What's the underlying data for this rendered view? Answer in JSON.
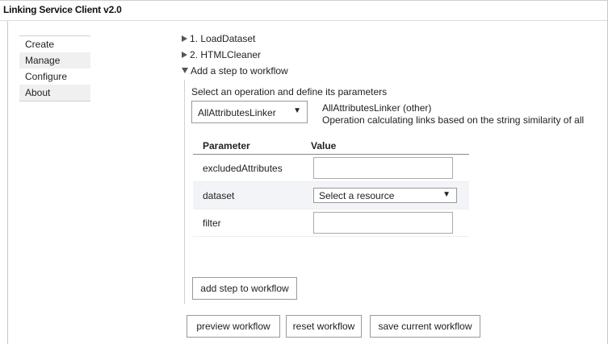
{
  "app": {
    "title": "Linking Service Client v2.0"
  },
  "sidebar": {
    "items": [
      {
        "label": "Create"
      },
      {
        "label": "Manage"
      },
      {
        "label": "Configure"
      },
      {
        "label": "About"
      }
    ]
  },
  "workflow": {
    "steps": [
      {
        "label": "1. LoadDataset",
        "expanded": false
      },
      {
        "label": "2. HTMLCleaner",
        "expanded": false
      }
    ],
    "add_step": {
      "label": "Add a step to workflow",
      "expanded": true
    }
  },
  "step_form": {
    "select_label": "Select an operation and define its parameters",
    "operation": {
      "selected": "AllAttributesLinker",
      "name": "AllAttributesLinker (other)",
      "description": "Operation calculating links based on the string similarity of all"
    },
    "table": {
      "headers": {
        "parameter": "Parameter",
        "value": "Value"
      },
      "rows": [
        {
          "name": "excludedAttributes",
          "input_type": "text",
          "value": ""
        },
        {
          "name": "dataset",
          "input_type": "select",
          "value": "Select a resource"
        },
        {
          "name": "filter",
          "input_type": "text",
          "value": ""
        }
      ]
    },
    "add_button": "add step to workflow"
  },
  "actions": {
    "preview": "preview workflow",
    "reset": "reset workflow",
    "save": "save current workflow"
  }
}
